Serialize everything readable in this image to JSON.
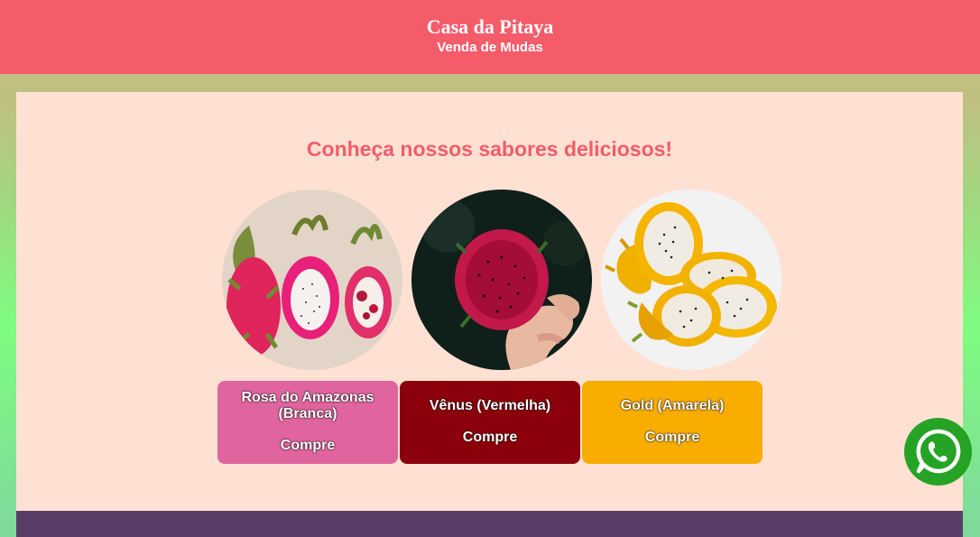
{
  "header": {
    "brand": "Casa da Pitaya",
    "subtitle": "Venda de Mudas"
  },
  "main": {
    "headline": "Conheça nossos sabores deliciosos!",
    "products": [
      {
        "name": "Rosa do Amazonas (Branca)",
        "buy_label": "Compre",
        "color": "#e0649e"
      },
      {
        "name": "Vênus (Vermelha)",
        "buy_label": "Compre",
        "color": "#8b000b"
      },
      {
        "name": "Gold (Amarela)",
        "buy_label": "Compre",
        "color": "#f8ad00"
      }
    ]
  },
  "floating": {
    "icon": "whatsapp-icon",
    "color": "#25a325"
  }
}
